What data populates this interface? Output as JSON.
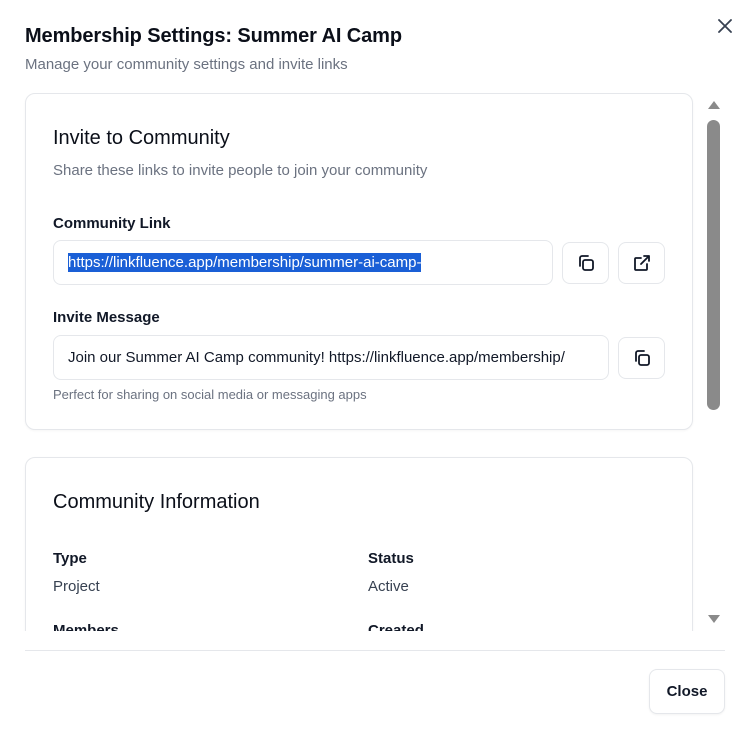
{
  "dialog": {
    "title": "Membership Settings: Summer AI Camp",
    "subtitle": "Manage your community settings and invite links",
    "close_button_label": "Close",
    "close_icon": "close-icon"
  },
  "invite": {
    "title": "Invite to Community",
    "description": "Share these links to invite people to join your community",
    "link_label": "Community Link",
    "link_value": "https://linkfluence.app/membership/summer-ai-camp-",
    "message_label": "Invite Message",
    "message_value": "Join our Summer AI Camp community! https://linkfluence.app/membership/",
    "hint": "Perfect for sharing on social media or messaging apps",
    "icons": {
      "copy": "copy-icon",
      "open": "external-link-icon"
    }
  },
  "info": {
    "title": "Community Information",
    "type_label": "Type",
    "type_value": "Project",
    "status_label": "Status",
    "status_value": "Active",
    "members_label": "Members",
    "created_label": "Created"
  },
  "colors": {
    "selection": "#1a5fd6",
    "muted_text": "#6b7280",
    "border": "#e5e7eb",
    "scroll_thumb": "#8a8a8a"
  }
}
